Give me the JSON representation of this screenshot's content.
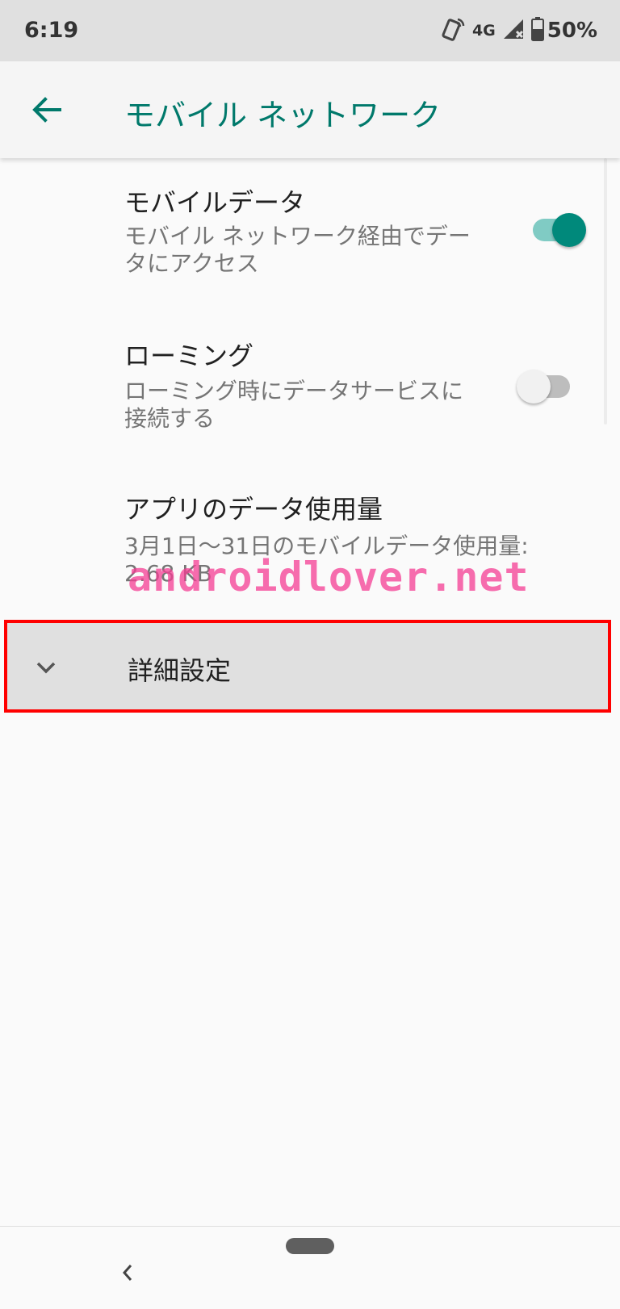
{
  "status_bar": {
    "time": "6:19",
    "network_type": "4G",
    "battery_percent": "50%"
  },
  "app_bar": {
    "title": "モバイル ネットワーク"
  },
  "preferences": [
    {
      "title": "モバイルデータ",
      "summary": "モバイル ネットワーク経由でデータにアクセス",
      "switch_on": true
    },
    {
      "title": "ローミング",
      "summary": "ローミング時にデータサービスに接続する",
      "switch_on": false
    },
    {
      "title": "アプリのデータ使用量",
      "summary": "3月1日～31日のモバイルデータ使用量: 2.68 KB"
    }
  ],
  "advanced": {
    "title": "詳細設定"
  },
  "watermark": "androidlover.net",
  "colors": {
    "accent": "#00796b",
    "switch_on": "#00897b",
    "highlight_border": "#ff0000",
    "watermark": "#f53d94"
  },
  "icons": {
    "back": "arrow-left-icon",
    "expand": "chevron-down-icon",
    "nav_back": "chevron-left-icon"
  }
}
